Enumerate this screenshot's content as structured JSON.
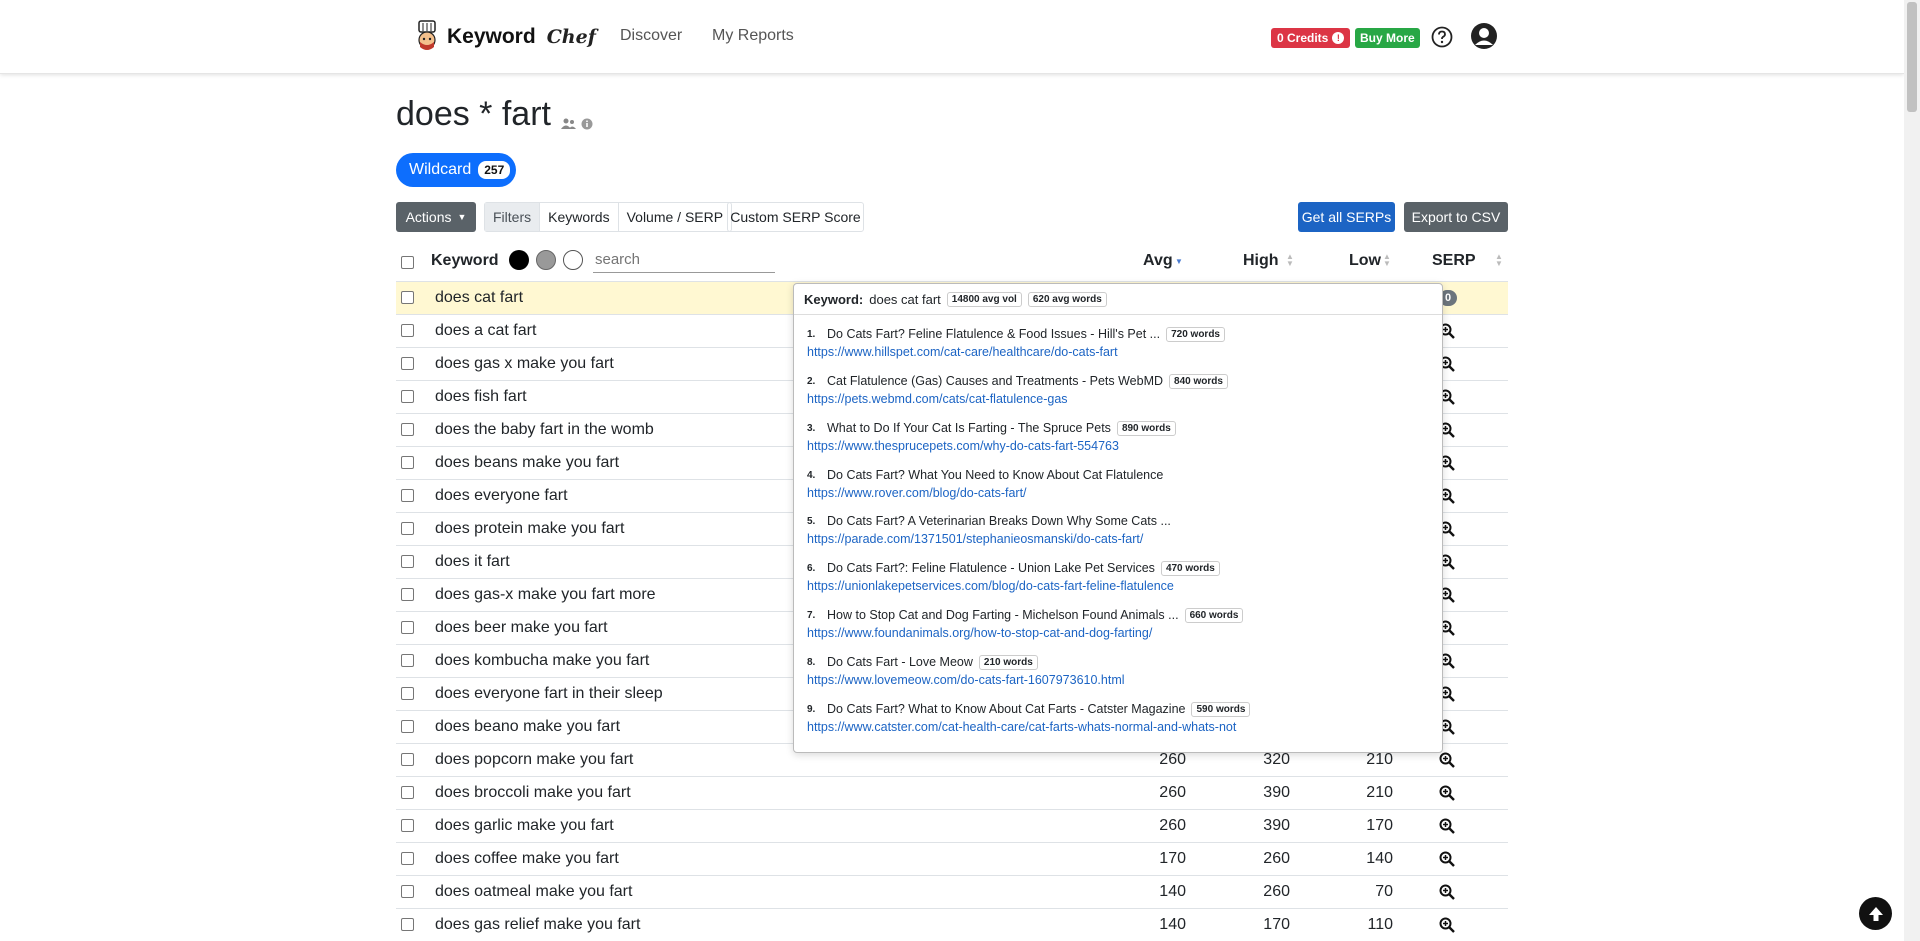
{
  "nav": {
    "brand": "Keyword",
    "brand_script": "Chef",
    "links": [
      "Discover",
      "My Reports"
    ],
    "credits": "0 Credits",
    "buy_more": "Buy More"
  },
  "page": {
    "title": "does * fart",
    "pill_label": "Wildcard",
    "pill_count": "257"
  },
  "toolbar": {
    "actions": "Actions",
    "tabs": [
      "Filters",
      "Keywords",
      "Volume / SERP"
    ],
    "custom_serp": "Custom SERP Score",
    "get_serps": "Get all SERPs",
    "export": "Export to CSV"
  },
  "table": {
    "headers": {
      "keyword": "Keyword",
      "avg": "Avg",
      "high": "High",
      "low": "Low",
      "serp": "SERP"
    },
    "search_placeholder": "search",
    "rows": [
      {
        "keyword": "does cat fart",
        "avg": "",
        "high": "",
        "low": ""
      },
      {
        "keyword": "does a cat fart",
        "avg": "",
        "high": "",
        "low": ""
      },
      {
        "keyword": "does gas x make you fart",
        "avg": "",
        "high": "",
        "low": ""
      },
      {
        "keyword": "does fish fart",
        "avg": "",
        "high": "",
        "low": ""
      },
      {
        "keyword": "does the baby fart in the womb",
        "avg": "",
        "high": "",
        "low": ""
      },
      {
        "keyword": "does beans make you fart",
        "avg": "",
        "high": "",
        "low": ""
      },
      {
        "keyword": "does everyone fart",
        "avg": "",
        "high": "",
        "low": ""
      },
      {
        "keyword": "does protein make you fart",
        "avg": "",
        "high": "",
        "low": ""
      },
      {
        "keyword": "does it fart",
        "avg": "",
        "high": "",
        "low": ""
      },
      {
        "keyword": "does gas-x make you fart more",
        "avg": "",
        "high": "",
        "low": ""
      },
      {
        "keyword": "does beer make you fart",
        "avg": "",
        "high": "",
        "low": ""
      },
      {
        "keyword": "does kombucha make you fart",
        "avg": "",
        "high": "",
        "low": ""
      },
      {
        "keyword": "does everyone fart in their sleep",
        "avg": "",
        "high": "",
        "low": ""
      },
      {
        "keyword": "does beano make you fart",
        "avg": "",
        "high": "",
        "low": ""
      },
      {
        "keyword": "does popcorn make you fart",
        "avg": "260",
        "high": "320",
        "low": "210"
      },
      {
        "keyword": "does broccoli make you fart",
        "avg": "260",
        "high": "390",
        "low": "210"
      },
      {
        "keyword": "does garlic make you fart",
        "avg": "260",
        "high": "390",
        "low": "170"
      },
      {
        "keyword": "does coffee make you fart",
        "avg": "170",
        "high": "260",
        "low": "140"
      },
      {
        "keyword": "does oatmeal make you fart",
        "avg": "140",
        "high": "260",
        "low": "70"
      },
      {
        "keyword": "does gas relief make you fart",
        "avg": "140",
        "high": "170",
        "low": "110"
      }
    ],
    "first_row_serp_badge": "0"
  },
  "popover": {
    "keyword_label": "Keyword:",
    "keyword": "does cat fart",
    "avg_vol": "14800 avg vol",
    "avg_words": "620 avg words",
    "results": [
      {
        "n": "1.",
        "title": "Do Cats Fart? Feline Flatulence & Food Issues - Hill's Pet ...",
        "words": "720 words",
        "url": "https://www.hillspet.com/cat-care/healthcare/do-cats-fart"
      },
      {
        "n": "2.",
        "title": "Cat Flatulence (Gas) Causes and Treatments - Pets WebMD",
        "words": "840 words",
        "url": "https://pets.webmd.com/cats/cat-flatulence-gas"
      },
      {
        "n": "3.",
        "title": "What to Do If Your Cat Is Farting - The Spruce Pets",
        "words": "890 words",
        "url": "https://www.thesprucepets.com/why-do-cats-fart-554763"
      },
      {
        "n": "4.",
        "title": "Do Cats Fart? What You Need to Know About Cat Flatulence",
        "words": "",
        "url": "https://www.rover.com/blog/do-cats-fart/"
      },
      {
        "n": "5.",
        "title": "Do Cats Fart? A Veterinarian Breaks Down Why Some Cats ...",
        "words": "",
        "url": "https://parade.com/1371501/stephanieosmanski/do-cats-fart/"
      },
      {
        "n": "6.",
        "title": "Do Cats Fart?: Feline Flatulence - Union Lake Pet Services",
        "words": "470 words",
        "url": "https://unionlakepetservices.com/blog/do-cats-fart-feline-flatulence"
      },
      {
        "n": "7.",
        "title": "How to Stop Cat and Dog Farting - Michelson Found Animals ...",
        "words": "660 words",
        "url": "https://www.foundanimals.org/how-to-stop-cat-and-dog-farting/"
      },
      {
        "n": "8.",
        "title": "Do Cats Fart - Love Meow",
        "words": "210 words",
        "url": "https://www.lovemeow.com/do-cats-fart-1607973610.html"
      },
      {
        "n": "9.",
        "title": "Do Cats Fart? What to Know About Cat Farts - Catster Magazine",
        "words": "590 words",
        "url": "https://www.catster.com/cat-health-care/cat-farts-whats-normal-and-whats-not"
      }
    ]
  },
  "colors": {
    "primary": "#0d6efd",
    "danger": "#dc3545",
    "success": "#28a745",
    "secondary": "#5a6268",
    "highlight": "#fff8d2",
    "link": "#1c64c4"
  },
  "icons": [
    "chef-logo-icon",
    "info-icon",
    "question-circle-icon",
    "user-circle-icon",
    "users-icon",
    "zoom-icon",
    "arrow-up-icon",
    "caret-down-icon"
  ]
}
